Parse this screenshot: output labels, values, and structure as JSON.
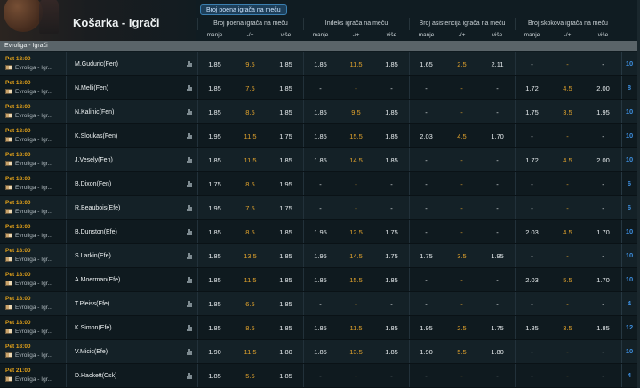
{
  "header": {
    "title": "Košarka - Igrači",
    "active_badge": "Broj poena igrača na meču",
    "groups": [
      "Broj poena igrača na meču",
      "Indeks igrača na meču",
      "Broj asistencija igrača na meču",
      "Broj skokova igrača na meču"
    ],
    "columns": [
      "manje",
      "-/+",
      "više"
    ]
  },
  "league_bar": "Evroliga - Igrači",
  "rows": [
    {
      "time": "Pet 18:00",
      "league": "Evroliga - Igr...",
      "player": "M.Guduric(Fen)",
      "cells": [
        "1.85",
        "9.5",
        "1.85",
        "1.85",
        "11.5",
        "1.85",
        "1.65",
        "2.5",
        "2.11",
        "-",
        "-",
        "-"
      ],
      "count": "10"
    },
    {
      "time": "Pet 18:00",
      "league": "Evroliga - Igr...",
      "player": "N.Melli(Fen)",
      "cells": [
        "1.85",
        "7.5",
        "1.85",
        "-",
        "-",
        "-",
        "-",
        "-",
        "-",
        "1.72",
        "4.5",
        "2.00"
      ],
      "count": "8"
    },
    {
      "time": "Pet 18:00",
      "league": "Evroliga - Igr...",
      "player": "N.Kalinic(Fen)",
      "cells": [
        "1.85",
        "8.5",
        "1.85",
        "1.85",
        "9.5",
        "1.85",
        "-",
        "-",
        "-",
        "1.75",
        "3.5",
        "1.95"
      ],
      "count": "10"
    },
    {
      "time": "Pet 18:00",
      "league": "Evroliga - Igr...",
      "player": "K.Sloukas(Fen)",
      "cells": [
        "1.95",
        "11.5",
        "1.75",
        "1.85",
        "15.5",
        "1.85",
        "2.03",
        "4.5",
        "1.70",
        "-",
        "-",
        "-"
      ],
      "count": "10"
    },
    {
      "time": "Pet 18:00",
      "league": "Evroliga - Igr...",
      "player": "J.Vesely(Fen)",
      "cells": [
        "1.85",
        "11.5",
        "1.85",
        "1.85",
        "14.5",
        "1.85",
        "-",
        "-",
        "-",
        "1.72",
        "4.5",
        "2.00"
      ],
      "count": "10"
    },
    {
      "time": "Pet 18:00",
      "league": "Evroliga - Igr...",
      "player": "B.Dixon(Fen)",
      "cells": [
        "1.75",
        "8.5",
        "1.95",
        "-",
        "-",
        "-",
        "-",
        "-",
        "-",
        "-",
        "-",
        "-"
      ],
      "count": "6"
    },
    {
      "time": "Pet 18:00",
      "league": "Evroliga - Igr...",
      "player": "R.Beaubois(Efe)",
      "cells": [
        "1.95",
        "7.5",
        "1.75",
        "-",
        "-",
        "-",
        "-",
        "-",
        "-",
        "-",
        "-",
        "-"
      ],
      "count": "6"
    },
    {
      "time": "Pet 18:00",
      "league": "Evroliga - Igr...",
      "player": "B.Dunston(Efe)",
      "cells": [
        "1.85",
        "8.5",
        "1.85",
        "1.95",
        "12.5",
        "1.75",
        "-",
        "-",
        "-",
        "2.03",
        "4.5",
        "1.70"
      ],
      "count": "10"
    },
    {
      "time": "Pet 18:00",
      "league": "Evroliga - Igr...",
      "player": "S.Larkin(Efe)",
      "cells": [
        "1.85",
        "13.5",
        "1.85",
        "1.95",
        "14.5",
        "1.75",
        "1.75",
        "3.5",
        "1.95",
        "-",
        "-",
        "-"
      ],
      "count": "10"
    },
    {
      "time": "Pet 18:00",
      "league": "Evroliga - Igr...",
      "player": "A.Moerman(Efe)",
      "cells": [
        "1.85",
        "11.5",
        "1.85",
        "1.85",
        "15.5",
        "1.85",
        "-",
        "-",
        "-",
        "2.03",
        "5.5",
        "1.70"
      ],
      "count": "10"
    },
    {
      "time": "Pet 18:00",
      "league": "Evroliga - Igr...",
      "player": "T.Pleiss(Efe)",
      "cells": [
        "1.85",
        "6.5",
        "1.85",
        "-",
        "-",
        "-",
        "-",
        "-",
        "-",
        "-",
        "-",
        "-"
      ],
      "count": "4"
    },
    {
      "time": "Pet 18:00",
      "league": "Evroliga - Igr...",
      "player": "K.Simon(Efe)",
      "cells": [
        "1.85",
        "8.5",
        "1.85",
        "1.85",
        "11.5",
        "1.85",
        "1.95",
        "2.5",
        "1.75",
        "1.85",
        "3.5",
        "1.85"
      ],
      "count": "12"
    },
    {
      "time": "Pet 18:00",
      "league": "Evroliga - Igr...",
      "player": "V.Micic(Efe)",
      "cells": [
        "1.90",
        "11.5",
        "1.80",
        "1.85",
        "13.5",
        "1.85",
        "1.90",
        "5.5",
        "1.80",
        "-",
        "-",
        "-"
      ],
      "count": "10"
    },
    {
      "time": "Pet 21:00",
      "league": "Evroliga - Igr...",
      "player": "D.Hackett(Csk)",
      "cells": [
        "1.85",
        "5.5",
        "1.85",
        "-",
        "-",
        "-",
        "-",
        "-",
        "-",
        "-",
        "-",
        "-"
      ],
      "count": "4"
    }
  ]
}
